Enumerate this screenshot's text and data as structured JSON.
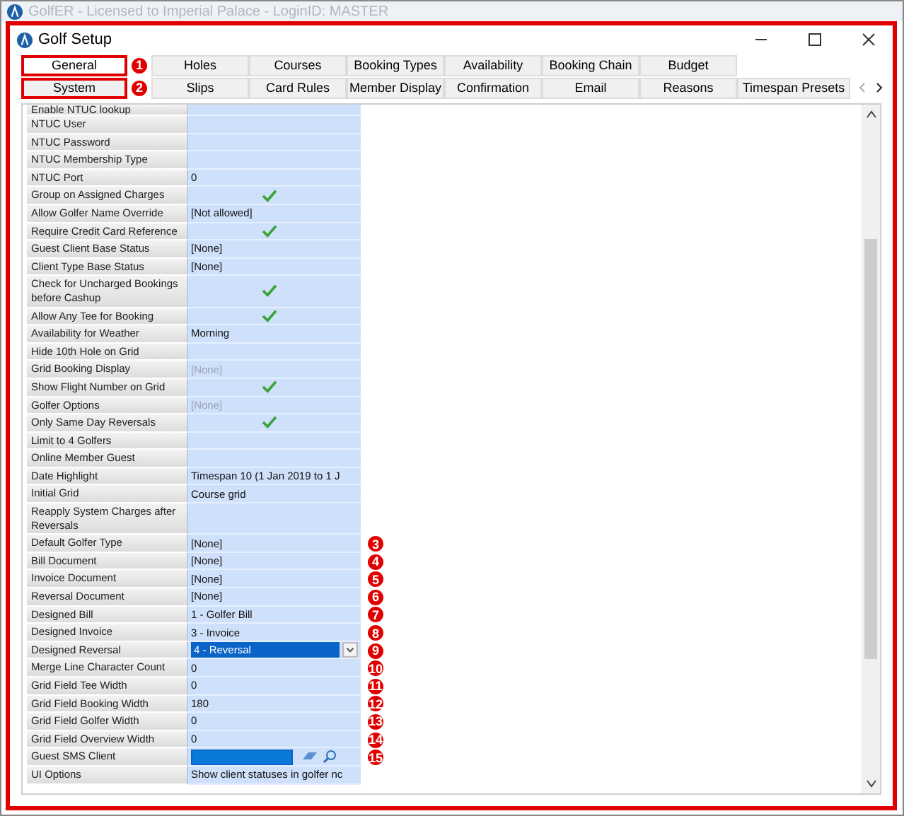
{
  "app_window": {
    "title": "GolfER - Licensed to Imperial Palace - LoginID: MASTER"
  },
  "window": {
    "title": "Golf Setup"
  },
  "tab_rows": [
    {
      "tabs": [
        {
          "label": "General",
          "selected": true,
          "badge": "1"
        },
        {
          "label": "Holes",
          "selected": false
        },
        {
          "label": "Courses",
          "selected": false
        },
        {
          "label": "Booking Types",
          "selected": false
        },
        {
          "label": "Availability",
          "selected": false
        },
        {
          "label": "Booking Chain",
          "selected": false
        },
        {
          "label": "Budget",
          "selected": false
        }
      ]
    },
    {
      "tabs": [
        {
          "label": "System",
          "selected": false,
          "badge": "2"
        },
        {
          "label": "Slips",
          "selected": false
        },
        {
          "label": "Card Rules",
          "selected": false
        },
        {
          "label": "Member Display",
          "selected": false
        },
        {
          "label": "Confirmation",
          "selected": false
        },
        {
          "label": "Email",
          "selected": false
        },
        {
          "label": "Reasons",
          "selected": false
        },
        {
          "label": "Timespan Presets",
          "selected": false
        }
      ]
    }
  ],
  "properties": [
    {
      "label": "Enable NTUC lookup",
      "kind": "text"
    },
    {
      "label": "NTUC User",
      "kind": "text"
    },
    {
      "label": "NTUC Password",
      "kind": "text"
    },
    {
      "label": "NTUC Membership Type",
      "kind": "text"
    },
    {
      "label": "NTUC Port",
      "kind": "text",
      "value": "0"
    },
    {
      "label": "Group on Assigned Charges",
      "kind": "check",
      "checked": true
    },
    {
      "label": "Allow Golfer Name Override",
      "kind": "text",
      "value": "[Not allowed]"
    },
    {
      "label": "Require Credit Card Reference",
      "kind": "check",
      "checked": true
    },
    {
      "label": "Guest Client Base Status",
      "kind": "text",
      "value": "[None]"
    },
    {
      "label": "Client Type Base Status",
      "kind": "text",
      "value": "[None]"
    },
    {
      "label": "Check for Uncharged Bookings before Cashup",
      "kind": "check",
      "checked": true
    },
    {
      "label": "Allow Any Tee for Booking",
      "kind": "check",
      "checked": true
    },
    {
      "label": "Availability for Weather",
      "kind": "text",
      "value": "Morning"
    },
    {
      "label": "Hide 10th Hole on Grid",
      "kind": "check",
      "checked": false
    },
    {
      "label": "Grid Booking Display",
      "kind": "dimmed",
      "value": "[None]"
    },
    {
      "label": "Show Flight Number on Grid",
      "kind": "check",
      "checked": true
    },
    {
      "label": "Golfer Options",
      "kind": "dimmed",
      "value": "[None]"
    },
    {
      "label": "Only Same Day Reversals",
      "kind": "check",
      "checked": true
    },
    {
      "label": "Limit to 4 Golfers",
      "kind": "check",
      "checked": false
    },
    {
      "label": "Online Member Guest",
      "kind": "check",
      "checked": false
    },
    {
      "label": "Date Highlight",
      "kind": "text",
      "value": "Timespan 10 (1 Jan 2019 to 1 J"
    },
    {
      "label": "Initial Grid",
      "kind": "text",
      "value": "Course grid"
    },
    {
      "label": "Reapply System Charges after Reversals",
      "kind": "check",
      "checked": false
    },
    {
      "label": "Default Golfer Type",
      "kind": "text",
      "value": "[None]",
      "badge": "3"
    },
    {
      "label": "Bill Document",
      "kind": "text",
      "value": "[None]",
      "badge": "4"
    },
    {
      "label": "Invoice Document",
      "kind": "text",
      "value": "[None]",
      "badge": "5"
    },
    {
      "label": "Reversal Document",
      "kind": "text",
      "value": "[None]",
      "badge": "6"
    },
    {
      "label": "Designed Bill",
      "kind": "text",
      "value": "1 - Golfer Bill",
      "badge": "7"
    },
    {
      "label": "Designed Invoice",
      "kind": "text",
      "value": "3 - Invoice",
      "badge": "8"
    },
    {
      "label": "Designed Reversal",
      "kind": "dropdown",
      "value": "4 - Reversal",
      "badge": "9"
    },
    {
      "label": "Merge Line Character Count",
      "kind": "text",
      "value": "0",
      "badge": "10"
    },
    {
      "label": "Grid Field Tee Width",
      "kind": "text",
      "value": "0",
      "badge": "11"
    },
    {
      "label": "Grid Field Booking Width",
      "kind": "text",
      "value": "180",
      "badge": "12"
    },
    {
      "label": "Grid Field Golfer Width",
      "kind": "text",
      "value": "0",
      "badge": "13"
    },
    {
      "label": "Grid Field Overview Width",
      "kind": "text",
      "value": "0",
      "badge": "14"
    },
    {
      "label": "Guest SMS Client",
      "kind": "field",
      "badge": "15"
    },
    {
      "label": "UI Options",
      "kind": "text",
      "value": "Show client statuses in golfer nc"
    }
  ]
}
